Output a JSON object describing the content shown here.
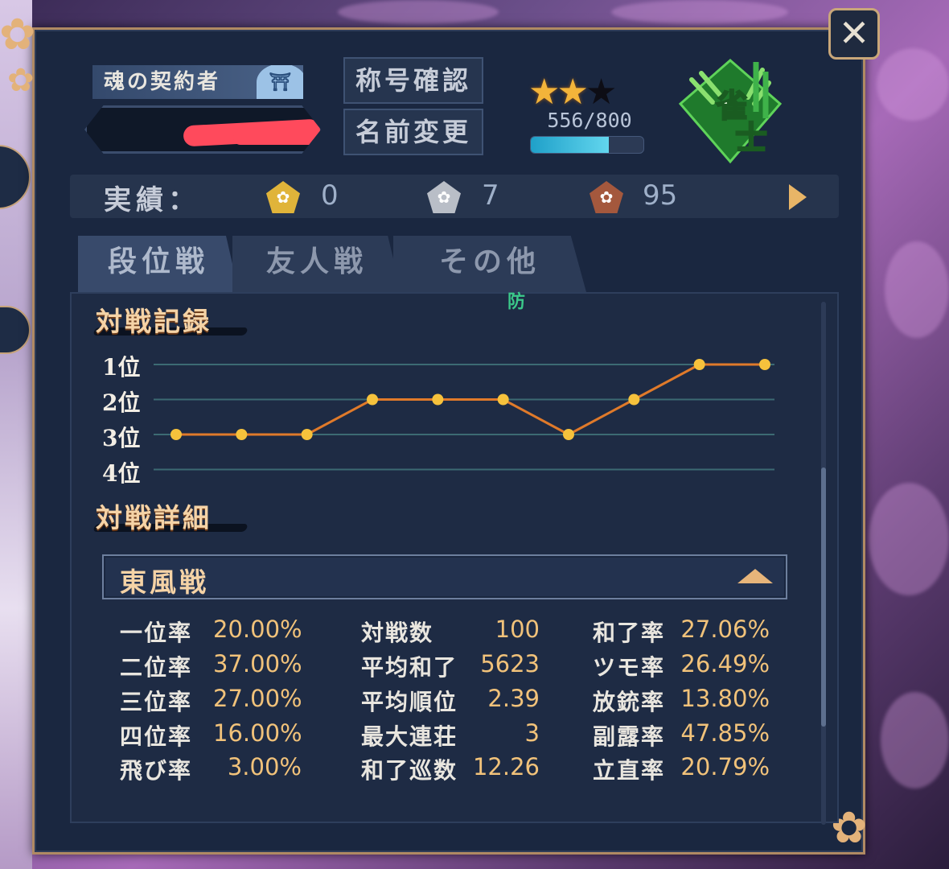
{
  "header": {
    "contract_title": "魂の契約者",
    "player_name_redacted": true,
    "title_button": "称号確認",
    "rename_button": "名前変更",
    "stars_filled": 2,
    "stars_total": 3,
    "points": "556/800",
    "points_progress": 0.695,
    "rank_label": "雀士"
  },
  "achievements": {
    "label": "実績：",
    "gold": "0",
    "silver": "7",
    "bronze": "95"
  },
  "tabs": [
    "段位戦",
    "友人戦",
    "その他"
  ],
  "floating_text": "防",
  "record": {
    "title": "対戦記録",
    "rank_labels": [
      "1位",
      "2位",
      "3位",
      "4位"
    ]
  },
  "chart_data": {
    "type": "line",
    "x": [
      1,
      2,
      3,
      4,
      5,
      6,
      7,
      8,
      9,
      10
    ],
    "series": [
      {
        "values": [
          3,
          3,
          3,
          2,
          2,
          2,
          3,
          2,
          1,
          1
        ]
      }
    ],
    "y_ticks": [
      "1位",
      "2位",
      "3位",
      "4位"
    ],
    "ylim": [
      1,
      4
    ],
    "grid": true,
    "colors": {
      "line": "#e07a2a",
      "point": "#f6c23c",
      "grid": "#3c6a73"
    }
  },
  "details": {
    "title": "対戦詳細",
    "mode": "東風戦",
    "col1": [
      {
        "label": "一位率",
        "value": "20.00%"
      },
      {
        "label": "二位率",
        "value": "37.00%"
      },
      {
        "label": "三位率",
        "value": "27.00%"
      },
      {
        "label": "四位率",
        "value": "16.00%"
      },
      {
        "label": "飛び率",
        "value": "3.00%"
      }
    ],
    "col2": [
      {
        "label": "対戦数",
        "value": "100"
      },
      {
        "label": "平均和了",
        "value": "5623"
      },
      {
        "label": "平均順位",
        "value": "2.39"
      },
      {
        "label": "最大連荘",
        "value": "3"
      },
      {
        "label": "和了巡数",
        "value": "12.26"
      }
    ],
    "col3": [
      {
        "label": "和了率",
        "value": "27.06%"
      },
      {
        "label": "ツモ率",
        "value": "26.49%"
      },
      {
        "label": "放銃率",
        "value": "13.80%"
      },
      {
        "label": "副露率",
        "value": "47.85%"
      },
      {
        "label": "立直率",
        "value": "20.79%"
      }
    ]
  }
}
